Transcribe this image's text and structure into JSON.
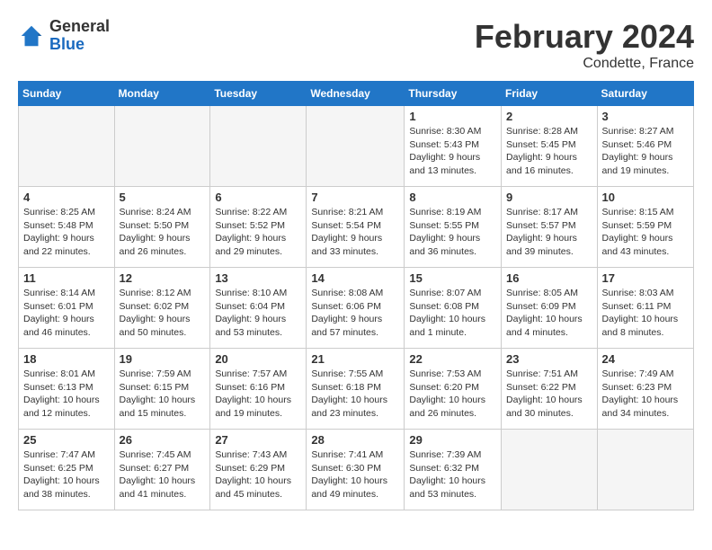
{
  "header": {
    "logo_general": "General",
    "logo_blue": "Blue",
    "month_year": "February 2024",
    "location": "Condette, France"
  },
  "weekdays": [
    "Sunday",
    "Monday",
    "Tuesday",
    "Wednesday",
    "Thursday",
    "Friday",
    "Saturday"
  ],
  "weeks": [
    [
      {
        "day": "",
        "info": ""
      },
      {
        "day": "",
        "info": ""
      },
      {
        "day": "",
        "info": ""
      },
      {
        "day": "",
        "info": ""
      },
      {
        "day": "1",
        "info": "Sunrise: 8:30 AM\nSunset: 5:43 PM\nDaylight: 9 hours\nand 13 minutes."
      },
      {
        "day": "2",
        "info": "Sunrise: 8:28 AM\nSunset: 5:45 PM\nDaylight: 9 hours\nand 16 minutes."
      },
      {
        "day": "3",
        "info": "Sunrise: 8:27 AM\nSunset: 5:46 PM\nDaylight: 9 hours\nand 19 minutes."
      }
    ],
    [
      {
        "day": "4",
        "info": "Sunrise: 8:25 AM\nSunset: 5:48 PM\nDaylight: 9 hours\nand 22 minutes."
      },
      {
        "day": "5",
        "info": "Sunrise: 8:24 AM\nSunset: 5:50 PM\nDaylight: 9 hours\nand 26 minutes."
      },
      {
        "day": "6",
        "info": "Sunrise: 8:22 AM\nSunset: 5:52 PM\nDaylight: 9 hours\nand 29 minutes."
      },
      {
        "day": "7",
        "info": "Sunrise: 8:21 AM\nSunset: 5:54 PM\nDaylight: 9 hours\nand 33 minutes."
      },
      {
        "day": "8",
        "info": "Sunrise: 8:19 AM\nSunset: 5:55 PM\nDaylight: 9 hours\nand 36 minutes."
      },
      {
        "day": "9",
        "info": "Sunrise: 8:17 AM\nSunset: 5:57 PM\nDaylight: 9 hours\nand 39 minutes."
      },
      {
        "day": "10",
        "info": "Sunrise: 8:15 AM\nSunset: 5:59 PM\nDaylight: 9 hours\nand 43 minutes."
      }
    ],
    [
      {
        "day": "11",
        "info": "Sunrise: 8:14 AM\nSunset: 6:01 PM\nDaylight: 9 hours\nand 46 minutes."
      },
      {
        "day": "12",
        "info": "Sunrise: 8:12 AM\nSunset: 6:02 PM\nDaylight: 9 hours\nand 50 minutes."
      },
      {
        "day": "13",
        "info": "Sunrise: 8:10 AM\nSunset: 6:04 PM\nDaylight: 9 hours\nand 53 minutes."
      },
      {
        "day": "14",
        "info": "Sunrise: 8:08 AM\nSunset: 6:06 PM\nDaylight: 9 hours\nand 57 minutes."
      },
      {
        "day": "15",
        "info": "Sunrise: 8:07 AM\nSunset: 6:08 PM\nDaylight: 10 hours\nand 1 minute."
      },
      {
        "day": "16",
        "info": "Sunrise: 8:05 AM\nSunset: 6:09 PM\nDaylight: 10 hours\nand 4 minutes."
      },
      {
        "day": "17",
        "info": "Sunrise: 8:03 AM\nSunset: 6:11 PM\nDaylight: 10 hours\nand 8 minutes."
      }
    ],
    [
      {
        "day": "18",
        "info": "Sunrise: 8:01 AM\nSunset: 6:13 PM\nDaylight: 10 hours\nand 12 minutes."
      },
      {
        "day": "19",
        "info": "Sunrise: 7:59 AM\nSunset: 6:15 PM\nDaylight: 10 hours\nand 15 minutes."
      },
      {
        "day": "20",
        "info": "Sunrise: 7:57 AM\nSunset: 6:16 PM\nDaylight: 10 hours\nand 19 minutes."
      },
      {
        "day": "21",
        "info": "Sunrise: 7:55 AM\nSunset: 6:18 PM\nDaylight: 10 hours\nand 23 minutes."
      },
      {
        "day": "22",
        "info": "Sunrise: 7:53 AM\nSunset: 6:20 PM\nDaylight: 10 hours\nand 26 minutes."
      },
      {
        "day": "23",
        "info": "Sunrise: 7:51 AM\nSunset: 6:22 PM\nDaylight: 10 hours\nand 30 minutes."
      },
      {
        "day": "24",
        "info": "Sunrise: 7:49 AM\nSunset: 6:23 PM\nDaylight: 10 hours\nand 34 minutes."
      }
    ],
    [
      {
        "day": "25",
        "info": "Sunrise: 7:47 AM\nSunset: 6:25 PM\nDaylight: 10 hours\nand 38 minutes."
      },
      {
        "day": "26",
        "info": "Sunrise: 7:45 AM\nSunset: 6:27 PM\nDaylight: 10 hours\nand 41 minutes."
      },
      {
        "day": "27",
        "info": "Sunrise: 7:43 AM\nSunset: 6:29 PM\nDaylight: 10 hours\nand 45 minutes."
      },
      {
        "day": "28",
        "info": "Sunrise: 7:41 AM\nSunset: 6:30 PM\nDaylight: 10 hours\nand 49 minutes."
      },
      {
        "day": "29",
        "info": "Sunrise: 7:39 AM\nSunset: 6:32 PM\nDaylight: 10 hours\nand 53 minutes."
      },
      {
        "day": "",
        "info": ""
      },
      {
        "day": "",
        "info": ""
      }
    ]
  ]
}
